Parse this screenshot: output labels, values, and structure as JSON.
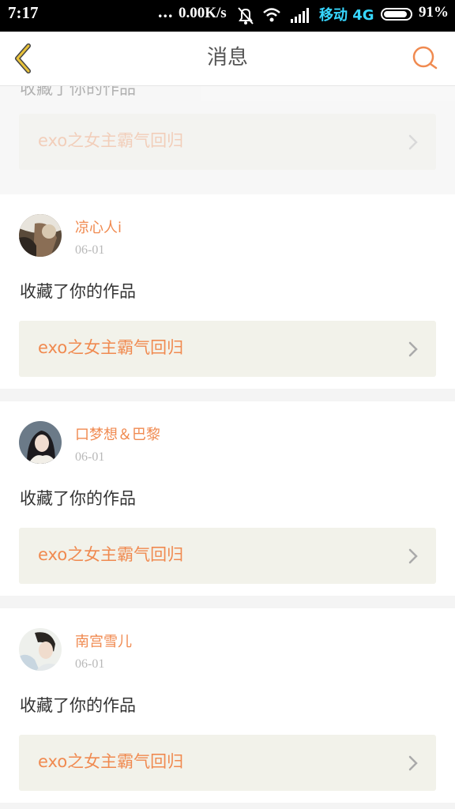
{
  "status_bar": {
    "time": "7:17",
    "dots": "...",
    "speed": "0.00K/s",
    "carrier": "移动 4G",
    "battery_percent": "91%",
    "battery_level": 0.91
  },
  "nav": {
    "title": "消息"
  },
  "top_partial": {
    "action": "收藏了你的作品",
    "work_title": "exo之女主霸气回归"
  },
  "messages": [
    {
      "username": "凉心人i",
      "date": "06-01",
      "action": "收藏了你的作品",
      "work_title": "exo之女主霸气回归"
    },
    {
      "username": "口梦想＆巴黎",
      "date": "06-01",
      "action": "收藏了你的作品",
      "work_title": "exo之女主霸气回归"
    },
    {
      "username": "南宫雪儿",
      "date": "06-01",
      "action": "收藏了你的作品",
      "work_title": "exo之女主霸气回归"
    }
  ],
  "colors": {
    "accent": "#f08a50",
    "back_arrow": "#e8c23a",
    "work_box_bg": "#f2f2ea"
  }
}
